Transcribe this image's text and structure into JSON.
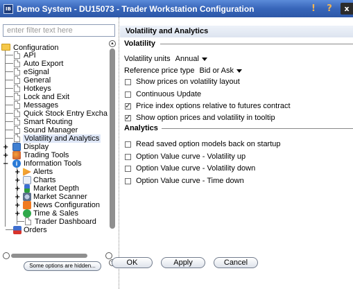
{
  "window": {
    "title": "Demo System - DU15073 - Trader Workstation Configuration",
    "app_icon_label": "IB",
    "pin_glyph": "!",
    "help_glyph": "?",
    "close_glyph": "x"
  },
  "filter": {
    "placeholder": "enter filter text here",
    "value": ""
  },
  "tree": {
    "items": [
      {
        "label": "Configuration",
        "icon": "folder-open-icon"
      },
      {
        "label": "API",
        "icon": "document-icon"
      },
      {
        "label": "Auto Export",
        "icon": "document-icon"
      },
      {
        "label": "eSignal",
        "icon": "document-icon"
      },
      {
        "label": "General",
        "icon": "document-icon"
      },
      {
        "label": "Hotkeys",
        "icon": "document-icon"
      },
      {
        "label": "Lock and Exit",
        "icon": "document-icon"
      },
      {
        "label": "Messages",
        "icon": "document-icon"
      },
      {
        "label": "Quick Stock Entry Excha",
        "icon": "document-icon"
      },
      {
        "label": "Smart Routing",
        "icon": "document-icon"
      },
      {
        "label": "Sound Manager",
        "icon": "document-icon"
      },
      {
        "label": "Volatility and Analytics",
        "icon": "document-icon",
        "selected": true
      },
      {
        "label": "Display",
        "icon": "display-icon"
      },
      {
        "label": "Trading Tools",
        "icon": "trading-tools-icon"
      },
      {
        "label": "Information Tools",
        "icon": "info-icon"
      },
      {
        "label": "Alerts",
        "icon": "alerts-icon"
      },
      {
        "label": "Charts",
        "icon": "charts-icon"
      },
      {
        "label": "Market Depth",
        "icon": "market-depth-icon"
      },
      {
        "label": "Market Scanner",
        "icon": "market-scanner-icon"
      },
      {
        "label": "News Configuration",
        "icon": "news-icon"
      },
      {
        "label": "Time & Sales",
        "icon": "time-sales-icon"
      },
      {
        "label": "Trader Dashboard",
        "icon": "document-icon"
      },
      {
        "label": "Orders",
        "icon": "orders-icon"
      }
    ]
  },
  "hidden_options_label": "Some options are hidden...",
  "panel": {
    "title": "Volatility and Analytics",
    "volatility_section": "Volatility",
    "volatility_units_label": "Volatility units",
    "volatility_units_value": "Annual",
    "reference_price_label": "Reference price type",
    "reference_price_value": "Bid or Ask",
    "options": [
      {
        "label": "Show prices on volatility layout",
        "checked": false
      },
      {
        "label": "Continuous Update",
        "checked": false
      },
      {
        "label": "Price index options relative to futures contract",
        "checked": true
      },
      {
        "label": "Show option prices and volatility in tooltip",
        "checked": true
      }
    ],
    "analytics_section": "Analytics",
    "analytics_options": [
      {
        "label": "Read saved option models back on startup",
        "checked": false
      },
      {
        "label": "Option Value curve - Volatility up",
        "checked": false
      },
      {
        "label": "Option Value curve - Volatility down",
        "checked": false
      },
      {
        "label": "Option Value curve - Time down",
        "checked": false
      }
    ]
  },
  "buttons": {
    "ok": "OK",
    "apply": "Apply",
    "cancel": "Cancel"
  }
}
